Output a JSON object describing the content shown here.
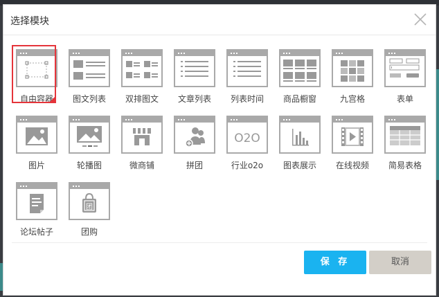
{
  "dialog": {
    "title": "选择模块",
    "save_label": "保 存",
    "cancel_label": "取消"
  },
  "colors": {
    "accent": "#1ab3f0",
    "selected": "#e5343a",
    "icon_gray": "#a9a9a9"
  },
  "modules": [
    {
      "label": "自由容器",
      "icon": "free-container-icon",
      "selected": true
    },
    {
      "label": "图文列表",
      "icon": "image-text-list-icon"
    },
    {
      "label": "双排图文",
      "icon": "double-image-text-icon"
    },
    {
      "label": "文章列表",
      "icon": "article-list-icon"
    },
    {
      "label": "列表时间",
      "icon": "list-time-icon"
    },
    {
      "label": "商品橱窗",
      "icon": "product-showcase-icon"
    },
    {
      "label": "九宫格",
      "icon": "nine-grid-icon"
    },
    {
      "label": "表单",
      "icon": "form-icon"
    },
    {
      "label": "图片",
      "icon": "picture-icon"
    },
    {
      "label": "轮播图",
      "icon": "carousel-icon"
    },
    {
      "label": "微商铺",
      "icon": "micro-shop-icon"
    },
    {
      "label": "拼团",
      "icon": "group-buy-icon"
    },
    {
      "label": "行业o2o",
      "icon": "o2o-icon",
      "icon_text": "O2O"
    },
    {
      "label": "图表展示",
      "icon": "chart-display-icon"
    },
    {
      "label": "在线视频",
      "icon": "video-icon"
    },
    {
      "label": "简易表格",
      "icon": "simple-table-icon"
    },
    {
      "label": "论坛帖子",
      "icon": "forum-post-icon"
    },
    {
      "label": "团购",
      "icon": "group-purchase-icon",
      "icon_text": "团"
    }
  ]
}
